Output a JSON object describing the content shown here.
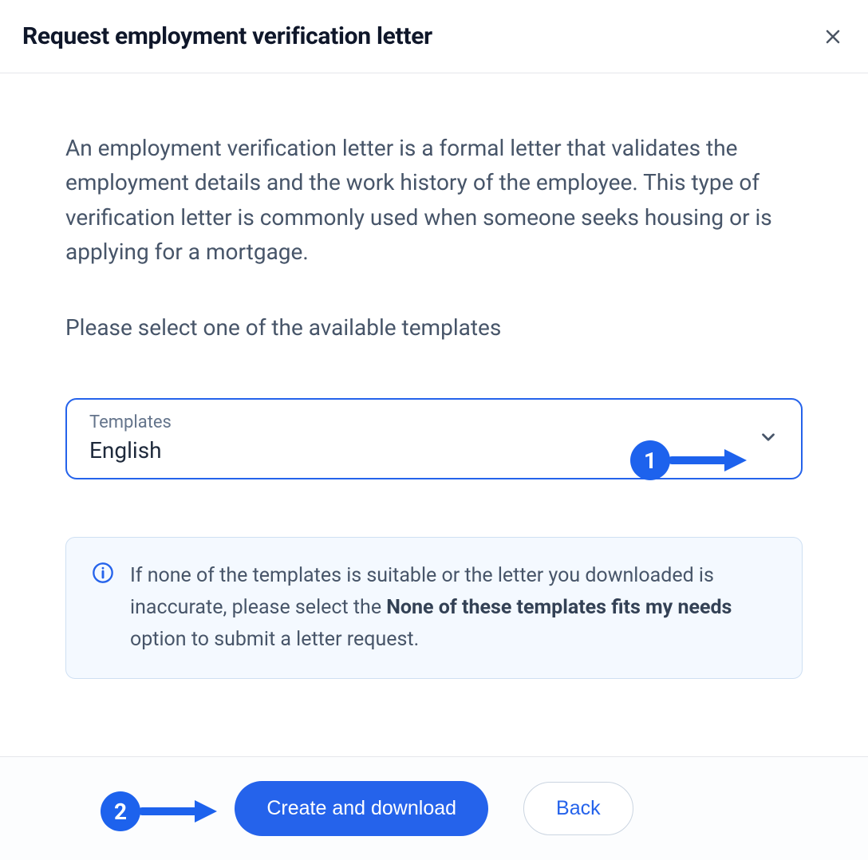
{
  "header": {
    "title": "Request employment verification letter"
  },
  "content": {
    "description": "An employment verification letter is a formal letter that validates the employment details and the work history of the employee. This type of verification letter is commonly used when someone seeks housing or is applying for a mortgage.",
    "instruction": "Please select one of the available templates"
  },
  "select": {
    "label": "Templates",
    "value": "English"
  },
  "infoBox": {
    "textBefore": "If none of the templates is suitable or the letter you downloaded is inaccurate, please select the ",
    "textBold": "None of these templates fits my needs",
    "textAfter": " option to submit a letter request."
  },
  "footer": {
    "primary": "Create and download",
    "secondary": "Back"
  },
  "annotations": {
    "a1": "1",
    "a2": "2"
  }
}
